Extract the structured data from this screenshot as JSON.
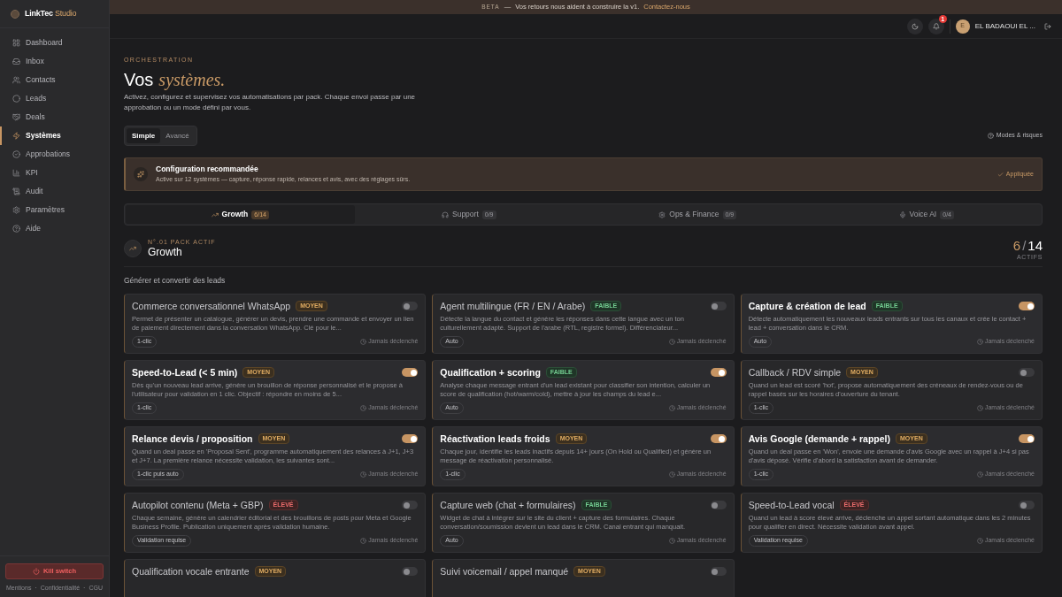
{
  "banner": {
    "tag": "BETA",
    "dash": "—",
    "text": "Vos retours nous aident à construire la v1.",
    "link": "Contactez-nous"
  },
  "brand": {
    "name": "LinkTec",
    "accent": "Studio"
  },
  "sidebar": {
    "items": [
      {
        "label": "Dashboard",
        "selected": false
      },
      {
        "label": "Inbox",
        "selected": false
      },
      {
        "label": "Contacts",
        "selected": false
      },
      {
        "label": "Leads",
        "selected": false
      },
      {
        "label": "Deals",
        "selected": false
      },
      {
        "label": "Systèmes",
        "selected": true
      },
      {
        "label": "Approbations",
        "selected": false
      },
      {
        "label": "KPI",
        "selected": false
      },
      {
        "label": "Audit",
        "selected": false
      },
      {
        "label": "Paramètres",
        "selected": false
      },
      {
        "label": "Aide",
        "selected": false
      }
    ],
    "kill_switch": "Kill switch",
    "footer": [
      "Mentions",
      "·",
      "Confidentialité",
      "·",
      "CGU"
    ]
  },
  "header": {
    "notifications": "1",
    "user": {
      "initial": "E",
      "name": "EL BADAOUI EL ..."
    }
  },
  "page": {
    "eyebrow": "ORCHESTRATION",
    "title": "Vos",
    "title_accent": "systèmes.",
    "description": "Activez, configurez et supervisez vos automatisations par pack. Chaque envoi passe par une approbation ou un mode défini par vous.",
    "modes": [
      {
        "label": "Simple",
        "selected": true
      },
      {
        "label": "Avancé",
        "selected": false
      }
    ],
    "help_link": "Modes & risques"
  },
  "recommendation": {
    "title": "Configuration recommandée",
    "text": "Active sur 12 systèmes — capture, réponse rapide, relances et avis, avec des réglages sûrs.",
    "status": "Appliquée"
  },
  "packs": [
    {
      "label": "Growth",
      "count": "6/14",
      "selected": true
    },
    {
      "label": "Support",
      "count": "0/9",
      "selected": false
    },
    {
      "label": "Ops & Finance",
      "count": "0/9",
      "selected": false
    },
    {
      "label": "Voice AI",
      "count": "0/4",
      "selected": false
    }
  ],
  "pack": {
    "eyebrow": "N°.01 PACK ACTIF",
    "name": "Growth",
    "active": "6",
    "separator": "/",
    "total": "14",
    "active_label": "ACTIFS"
  },
  "section": "Générer et convertir des leads",
  "systems": [
    {
      "title": "Commerce conversationnel WhatsApp",
      "kind": "moyen",
      "risk_label": "MOYEN",
      "on": false,
      "description": "Permet de présenter un catalogue, générer un devis, prendre une commande et envoyer un lien de paiement directement dans la conversation WhatsApp. Clé pour le...",
      "mode": "1-clic",
      "last_run": "Jamais déclenché"
    },
    {
      "title": "Agent multilingue (FR / EN / Arabe)",
      "kind": "faible",
      "risk_label": "FAIBLE",
      "on": false,
      "description": "Détecte la langue du contact et génère les réponses dans cette langue avec un ton culturellement adapté. Support de l'arabe (RTL, registre formel). Différenciateur...",
      "mode": "Auto",
      "last_run": "Jamais déclenché"
    },
    {
      "title": "Capture & création de lead",
      "kind": "faible",
      "risk_label": "FAIBLE",
      "on": true,
      "description": "Détecte automatiquement les nouveaux leads entrants sur tous les canaux et crée le contact + lead + conversation dans le CRM.",
      "mode": "Auto",
      "last_run": "Jamais déclenché"
    },
    {
      "title": "Speed-to-Lead (< 5 min)",
      "kind": "moyen",
      "risk_label": "MOYEN",
      "on": true,
      "description": "Dès qu'un nouveau lead arrive, génère un brouillon de réponse personnalisé et le propose à l'utilisateur pour validation en 1 clic. Objectif : répondre en moins de 5...",
      "mode": "1-clic",
      "last_run": "Jamais déclenché"
    },
    {
      "title": "Qualification + scoring",
      "kind": "faible",
      "risk_label": "FAIBLE",
      "on": true,
      "description": "Analyse chaque message entrant d'un lead existant pour classifier son intention, calculer un score de qualification (hot/warm/cold), mettre à jour les champs du lead e...",
      "mode": "Auto",
      "last_run": "Jamais déclenché"
    },
    {
      "title": "Callback / RDV simple",
      "kind": "moyen",
      "risk_label": "MOYEN",
      "on": false,
      "description": "Quand un lead est scoré 'hot', propose automatiquement des créneaux de rendez-vous ou de rappel basés sur les horaires d'ouverture du tenant.",
      "mode": "1-clic",
      "last_run": "Jamais déclenché"
    },
    {
      "title": "Relance devis / proposition",
      "kind": "moyen",
      "risk_label": "MOYEN",
      "on": true,
      "description": "Quand un deal passe en 'Proposal Sent', programme automatiquement des relances à J+1, J+3 et J+7. La première relance nécessite validation, les suivantes sont...",
      "mode": "1-clic puis auto",
      "last_run": "Jamais déclenché"
    },
    {
      "title": "Réactivation leads froids",
      "kind": "moyen",
      "risk_label": "MOYEN",
      "on": true,
      "description": "Chaque jour, identifie les leads inactifs depuis 14+ jours (On Hold ou Qualified) et génère un message de réactivation personnalisé.",
      "mode": "1-clic",
      "last_run": "Jamais déclenché"
    },
    {
      "title": "Avis Google (demande + rappel)",
      "kind": "moyen",
      "risk_label": "MOYEN",
      "on": true,
      "description": "Quand un deal passe en 'Won', envoie une demande d'avis Google avec un rappel à J+4 si pas d'avis déposé. Vérifie d'abord la satisfaction avant de demander.",
      "mode": "1-clic",
      "last_run": "Jamais déclenché"
    },
    {
      "title": "Autopilot contenu (Meta + GBP)",
      "kind": "eleve",
      "risk_label": "ÉLEVÉ",
      "on": false,
      "description": "Chaque semaine, génère un calendrier éditorial et des brouillons de posts pour Meta et Google Business Profile. Publication uniquement après validation humaine.",
      "mode": "Validation requise",
      "last_run": "Jamais déclenché"
    },
    {
      "title": "Capture web (chat + formulaires)",
      "kind": "faible",
      "risk_label": "FAIBLE",
      "on": false,
      "description": "Widget de chat à intégrer sur le site du client + capture des formulaires. Chaque conversation/soumission devient un lead dans le CRM. Canal entrant qui manquait.",
      "mode": "Auto",
      "last_run": "Jamais déclenché"
    },
    {
      "title": "Speed-to-Lead vocal",
      "kind": "eleve",
      "risk_label": "ÉLEVÉ",
      "on": false,
      "description": "Quand un lead à score élevé arrive, déclenche un appel sortant automatique dans les 2 minutes pour qualifier en direct. Nécessite validation avant appel.",
      "mode": "Validation requise",
      "last_run": "Jamais déclenché"
    },
    {
      "title": "Qualification vocale entrante",
      "kind": "moyen",
      "risk_label": "MOYEN",
      "on": false
    },
    {
      "title": "Suivi voicemail / appel manqué",
      "kind": "moyen",
      "risk_label": "MOYEN",
      "on": false
    }
  ]
}
